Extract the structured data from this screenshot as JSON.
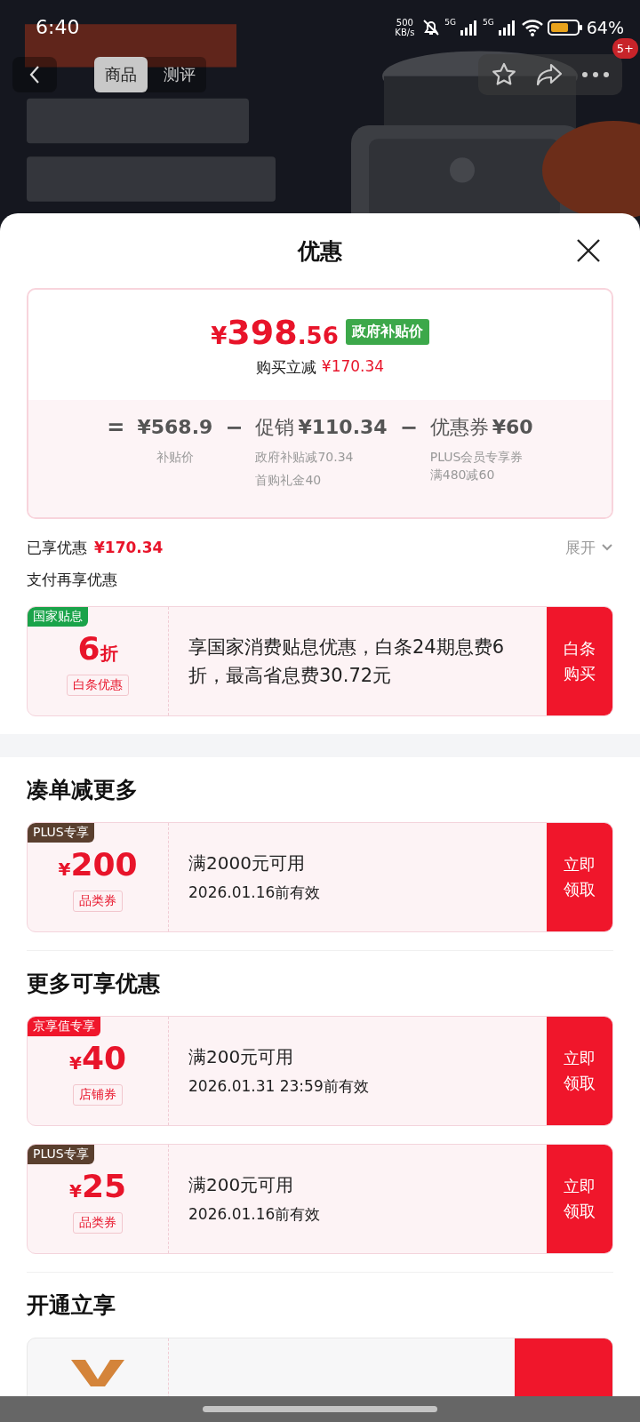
{
  "status_bar": {
    "time": "6:40",
    "net_speed": "500",
    "net_unit": "KB/s",
    "signals": [
      "5G",
      "5G"
    ],
    "battery": "64%"
  },
  "header": {
    "tabs": [
      {
        "label": "商品",
        "selected": true
      },
      {
        "label": "测评",
        "selected": false
      }
    ],
    "badge": "5+"
  },
  "sheet": {
    "title": "优惠"
  },
  "price_summary": {
    "currency": "¥",
    "price_int": "398",
    "price_dec": ".56",
    "tag": "政府补贴价",
    "discount_label": "购买立减",
    "discount_amount": "¥170.34",
    "equals": "=",
    "items": [
      {
        "value": "¥568.9",
        "notes": [
          "补贴价"
        ]
      },
      {
        "operator": "−",
        "label": "促销",
        "value": "¥110.34",
        "notes": [
          "政府补贴减70.34",
          "首购礼金40"
        ]
      },
      {
        "operator": "−",
        "label": "优惠券",
        "value": "¥60",
        "notes": [
          "PLUS会员专享券满480减60"
        ]
      }
    ]
  },
  "enjoyed": {
    "label": "已享优惠",
    "amount": "¥170.34",
    "expand": "展开"
  },
  "pay_offer": {
    "title": "支付再享优惠",
    "badge": "国家贴息",
    "color": "#1aa34a",
    "value": "6",
    "unit": "折",
    "tag": "白条优惠",
    "description": "享国家消费贴息优惠，白条24期息费6折，最高省息费30.72元",
    "button": "白条购买"
  },
  "sections": [
    {
      "title": "凑单减更多",
      "coupons": [
        {
          "badge": "PLUS专享",
          "color": "#5a3f2e",
          "currency": "¥",
          "amount": "200",
          "tag": "品类券",
          "condition": "满2000元可用",
          "validity": "2026.01.16前有效",
          "button": "立即领取"
        }
      ]
    },
    {
      "title": "更多可享优惠",
      "coupons": [
        {
          "badge": "京享值专享",
          "color": "#f0162b",
          "currency": "¥",
          "amount": "40",
          "tag": "店铺券",
          "condition": "满200元可用",
          "validity": "2026.01.31 23:59前有效",
          "button": "立即领取"
        },
        {
          "badge": "PLUS专享",
          "color": "#5a3f2e",
          "currency": "¥",
          "amount": "25",
          "tag": "品类券",
          "condition": "满200元可用",
          "validity": "2026.01.16前有效",
          "button": "立即领取"
        }
      ]
    },
    {
      "title": "开通立享",
      "coupons": [
        {
          "kind": "membership"
        }
      ]
    }
  ]
}
